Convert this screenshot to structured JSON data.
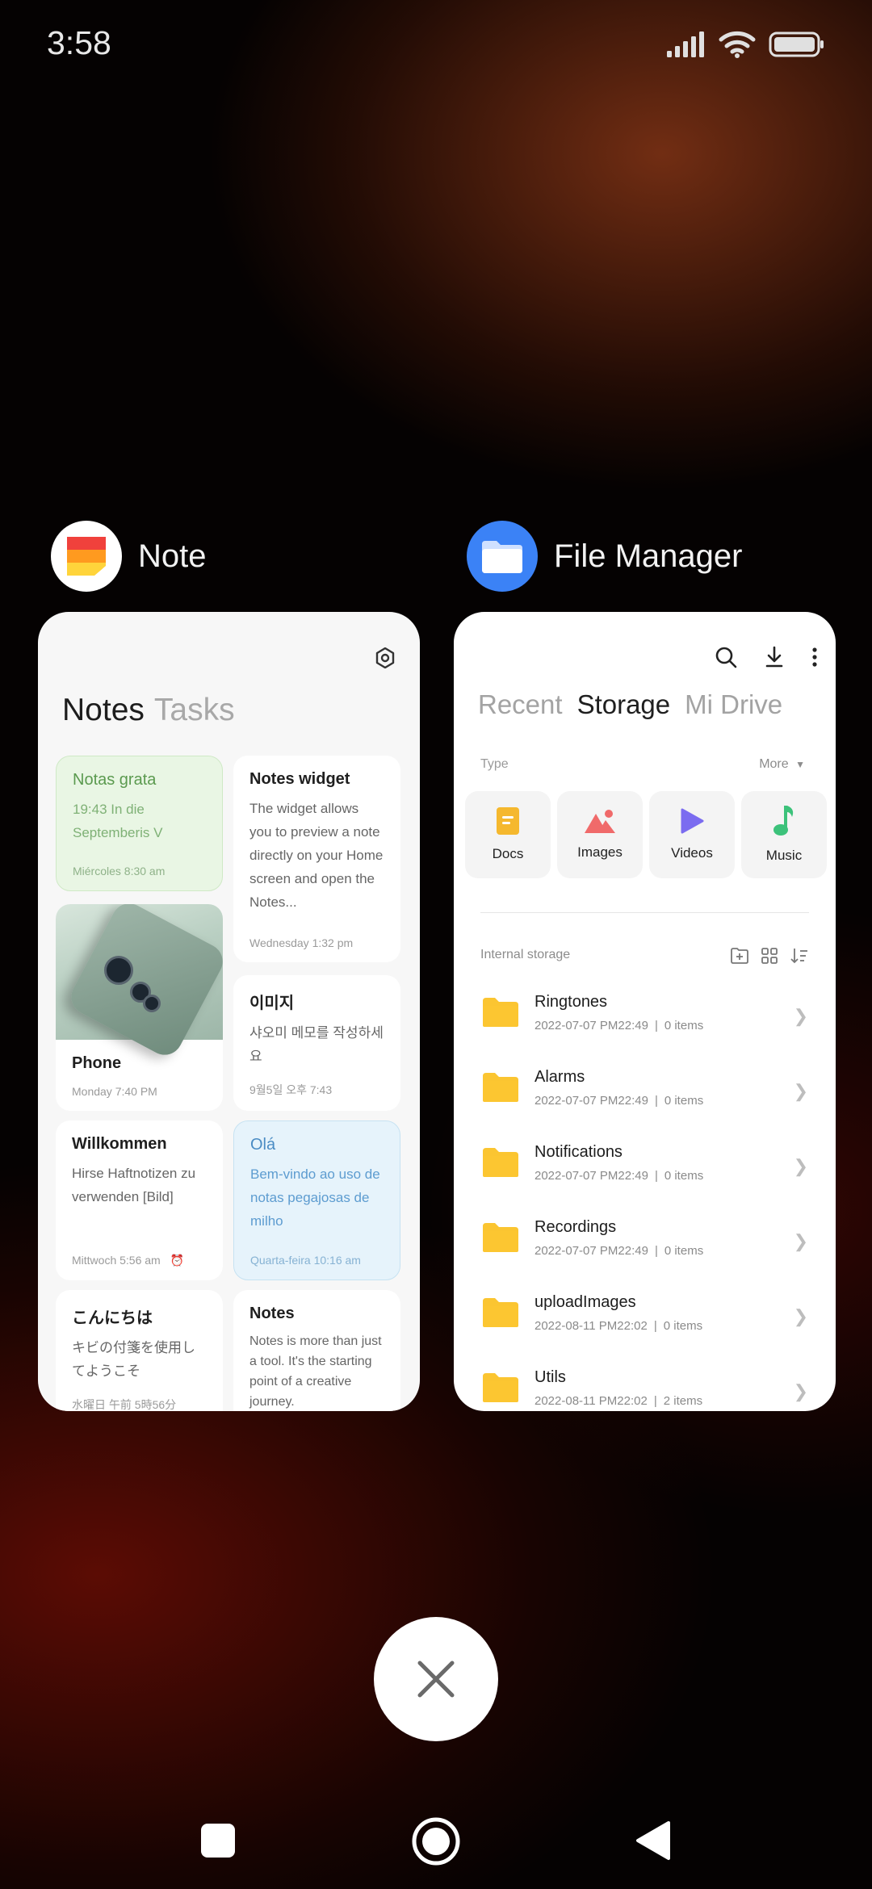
{
  "status_bar": {
    "time": "3:58"
  },
  "apps": {
    "note": {
      "name": "Note"
    },
    "file_manager": {
      "name": "File Manager"
    }
  },
  "note_app": {
    "tabs": {
      "notes": "Notes",
      "tasks": "Tasks"
    },
    "cards": [
      {
        "title": "Notas grata",
        "body": "19:43 In die Septemberis V",
        "date": "Miércoles 8:30 am"
      },
      {
        "title": "Notes widget",
        "body": "The widget allows you to preview a note directly on your Home screen and open the Notes...",
        "date": "Wednesday 1:32 pm"
      },
      {
        "title": "Phone",
        "date": "Monday 7:40 PM"
      },
      {
        "title": "이미지",
        "body": "샤오미 메모를 작성하세요",
        "date": "9월5일 오후 7:43"
      },
      {
        "title": "Willkommen",
        "body": "Hirse Haftnotizen zu verwenden [Bild]",
        "date": "Mittwoch 5:56 am"
      },
      {
        "title": "Olá",
        "body": "Bem-vindo ao uso de notas pegajosas de milho",
        "date": "Quarta-feira 10:16 am"
      },
      {
        "title": "こんにちは",
        "body": "キビの付箋を使用してようこそ",
        "date": "水曜日 午前 5時56分"
      },
      {
        "title": "Notes",
        "body": "Notes is more than just a tool. It's the starting point of a creative journey."
      }
    ]
  },
  "file_manager_app": {
    "tabs": {
      "recent": "Recent",
      "storage": "Storage",
      "mi_drive": "Mi Drive"
    },
    "type_label": "Type",
    "more_label": "More",
    "types": [
      {
        "label": "Docs",
        "color": "#F5B82E"
      },
      {
        "label": "Images",
        "color": "#F06A6A"
      },
      {
        "label": "Videos",
        "color": "#7B6CF0"
      },
      {
        "label": "Music",
        "color": "#3CC27A"
      }
    ],
    "internal_storage_label": "Internal storage",
    "folders": [
      {
        "name": "Ringtones",
        "date": "2022-07-07 PM22:49",
        "count": "0 items"
      },
      {
        "name": "Alarms",
        "date": "2022-07-07 PM22:49",
        "count": "0 items"
      },
      {
        "name": "Notifications",
        "date": "2022-07-07 PM22:49",
        "count": "0 items"
      },
      {
        "name": "Recordings",
        "date": "2022-07-07 PM22:49",
        "count": "0 items"
      },
      {
        "name": "uploadImages",
        "date": "2022-08-11 PM22:02",
        "count": "0 items"
      },
      {
        "name": "Utils",
        "date": "2022-08-11 PM22:02",
        "count": "2 items"
      }
    ],
    "folder_color": "#FBC531"
  }
}
